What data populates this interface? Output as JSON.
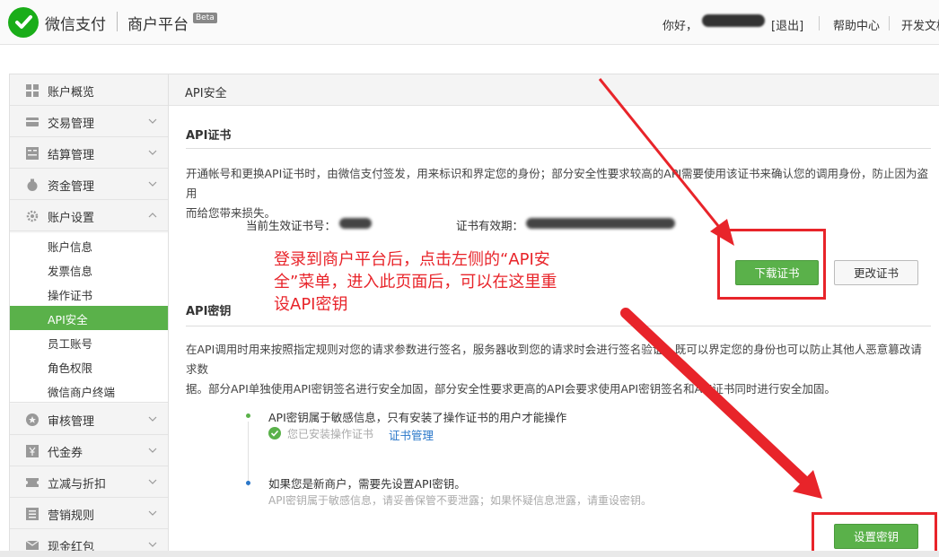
{
  "header": {
    "brand": "微信支付",
    "platform": "商户平台",
    "beta": "Beta",
    "greeting": "你好，",
    "logout": "[退出]",
    "help": "帮助中心",
    "dev_docs": "开发文档"
  },
  "sidebar": {
    "items": [
      {
        "label": "账户概览",
        "icon": "grid-icon"
      },
      {
        "label": "交易管理",
        "icon": "card-icon"
      },
      {
        "label": "结算管理",
        "icon": "ledger-icon"
      },
      {
        "label": "资金管理",
        "icon": "money-bag-icon"
      },
      {
        "label": "账户设置",
        "icon": "gear-icon"
      },
      {
        "label": "审核管理",
        "icon": "star-badge-icon"
      },
      {
        "label": "代金券",
        "icon": "yen-icon"
      },
      {
        "label": "立减与折扣",
        "icon": "ticket-icon"
      },
      {
        "label": "营销规则",
        "icon": "list-icon"
      },
      {
        "label": "现金红包",
        "icon": "envelope-icon"
      }
    ],
    "sub_items": [
      "账户信息",
      "发票信息",
      "操作证书",
      "API安全",
      "员工账号",
      "角色权限",
      "微信商户终端"
    ],
    "active_sub": "API安全"
  },
  "main": {
    "page_title": "API安全",
    "cert": {
      "title": "API证书",
      "desc_line1": "开通帐号和更换API证书时，由微信支付签发，用来标识和界定您的身份；部分安全性要求较高的API需要使用该证书来确认您的调用身份，防止因为盗用",
      "desc_line2": "而给您带来损失。",
      "current_label": "当前生效证书号：",
      "validity_label": "证书有效期：",
      "download_button": "下载证书",
      "change_button": "更改证书"
    },
    "key": {
      "title": "API密钥",
      "desc_line1": "在API调用时用来按照指定规则对您的请求参数进行签名，服务器收到您的请求时会进行签名验证，既可以界定您的身份也可以防止其他人恶意篡改请求数",
      "desc_line2": "据。部分API单独使用API密钥签名进行安全加固，部分安全性要求更高的API会要求使用API密钥签名和API证书同时进行安全加固。",
      "step1_title": "API密钥属于敏感信息，只有安装了操作证书的用户才能操作",
      "step1_status": "您已安装操作证书",
      "step1_link": "证书管理",
      "step2_title": "如果您是新商户，需要先设置API密钥。",
      "step2_note": "API密钥属于敏感信息，请妥善保管不要泄露；如果怀疑信息泄露，请重设密钥。",
      "set_button": "设置密钥"
    }
  },
  "annotation": {
    "line1": "登录到商户平台后，点击左侧的“API安",
    "line2": "全”菜单，进入此页面后，可以在这里重",
    "line3": "设API密钥"
  },
  "colors": {
    "green": "#5ab14a",
    "red": "#e8242a",
    "link": "#2a77c9"
  }
}
